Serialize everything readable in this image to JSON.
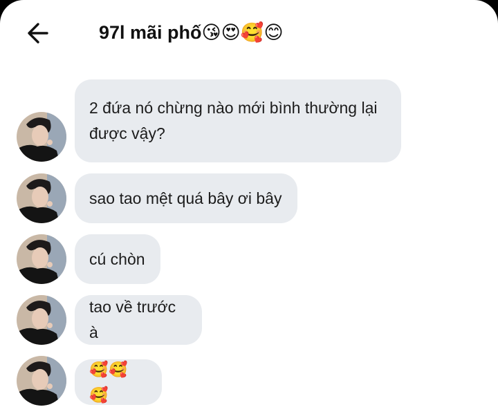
{
  "header": {
    "back_icon": "arrow-left-icon",
    "title": "97l mãi phố😘😍🥰😊"
  },
  "messages": [
    {
      "text": "2 đứa nó chừng nào mới bình thường lại được vậy?"
    },
    {
      "text": "sao tao mệt quá bây ơi bây"
    },
    {
      "text": "cú chòn"
    },
    {
      "text": "tao về trước à"
    },
    {
      "text": "🥰🥰🥰"
    }
  ],
  "colors": {
    "bubble_bg": "#e8ebef",
    "text": "#1c1c1c",
    "background": "#ffffff"
  }
}
